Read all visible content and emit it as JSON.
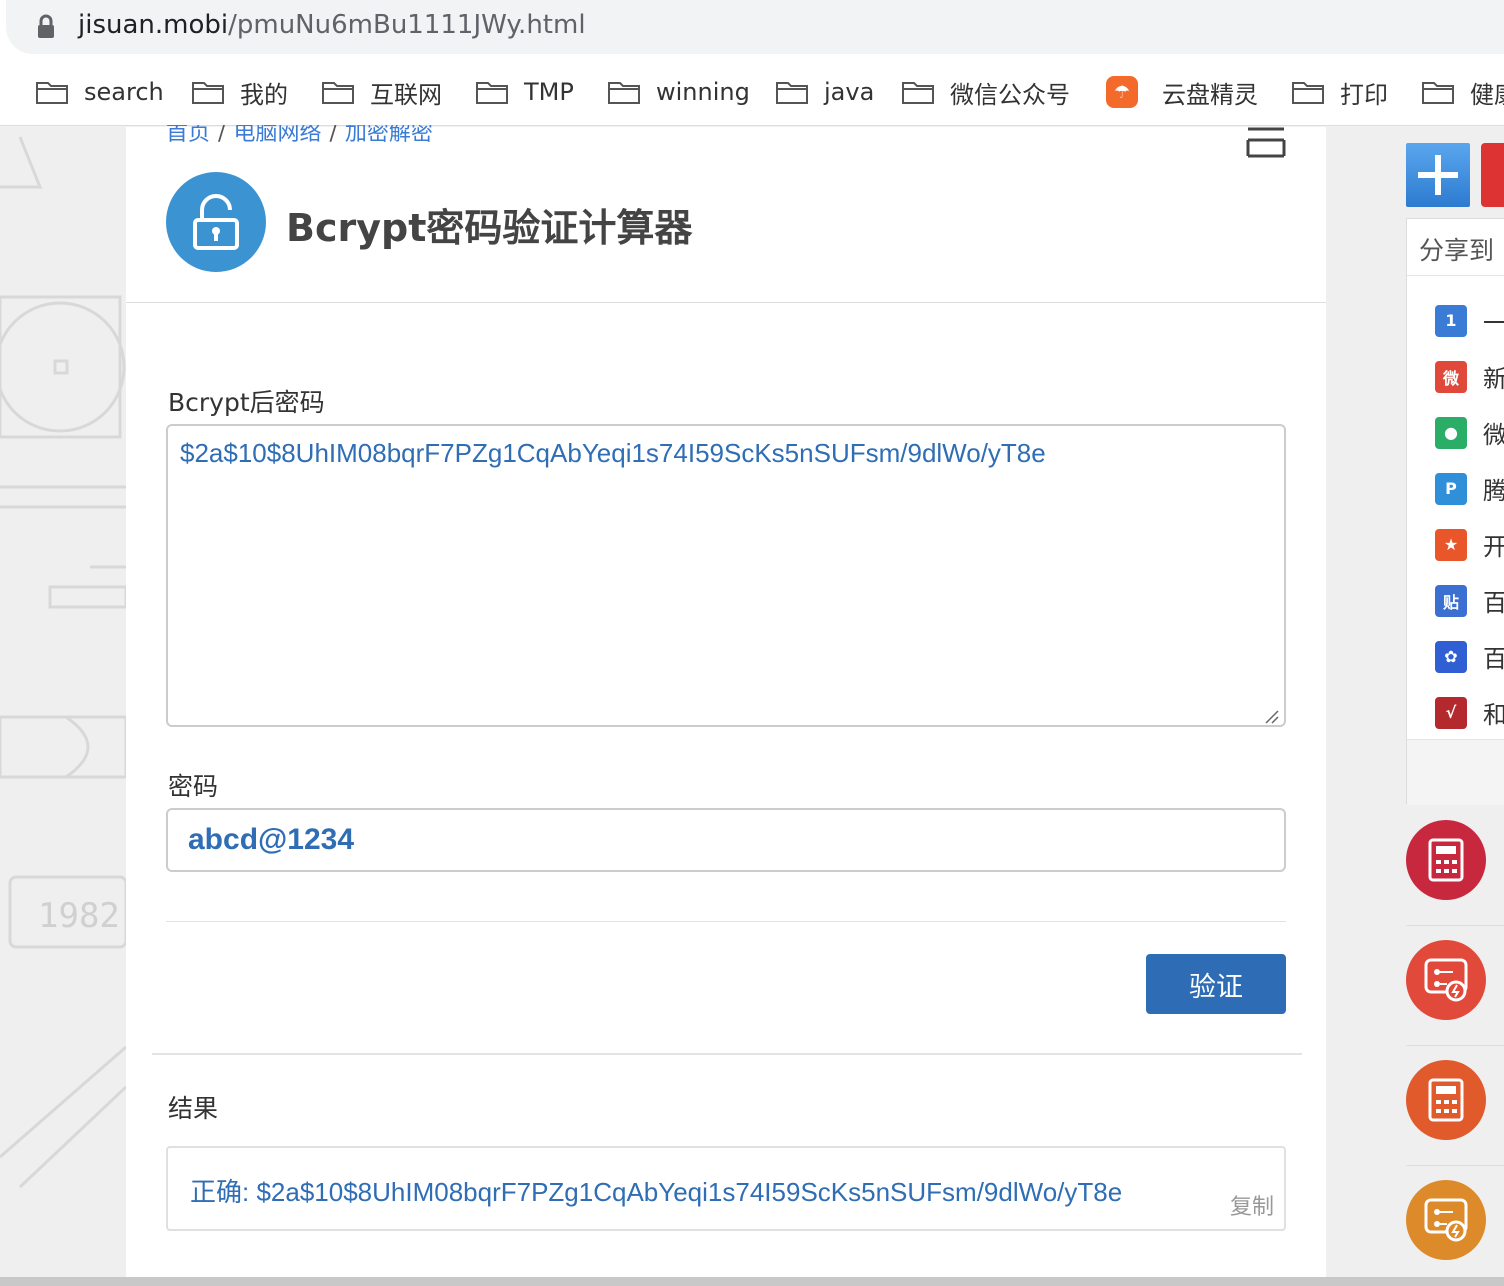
{
  "browser": {
    "url_domain": "jisuan.mobi",
    "url_path": "/pmuNu6mBu1111JWy.html",
    "bookmarks": [
      {
        "label": "search",
        "type": "folder"
      },
      {
        "label": "我的",
        "type": "folder"
      },
      {
        "label": "互联网",
        "type": "folder"
      },
      {
        "label": "TMP",
        "type": "folder"
      },
      {
        "label": "winning",
        "type": "folder"
      },
      {
        "label": "java",
        "type": "folder"
      },
      {
        "label": "微信公众号",
        "type": "folder"
      },
      {
        "label": "云盘精灵",
        "type": "app"
      },
      {
        "label": "打印",
        "type": "folder"
      },
      {
        "label": "健康",
        "type": "folder"
      }
    ]
  },
  "breadcrumb": {
    "home": "首页",
    "category": "电脑网络",
    "subcategory": "加密解密",
    "separator": "/"
  },
  "tool": {
    "title": "Bcrypt密码验证计算器",
    "icon": "lock-icon"
  },
  "form": {
    "hash_label": "Bcrypt后密码",
    "hash_value": "$2a$10$8UhIM08bqrF7PZg1CqAbYeqi1s74I59ScKs5nSUFsm/9dlWo/yT8e",
    "password_label": "密码",
    "password_value": "abcd@1234",
    "verify_button": "验证"
  },
  "result": {
    "label": "结果",
    "text": "正确: $2a$10$8UhIM08bqrF7PZg1CqAbYeqi1s74I59ScKs5nSUFsm/9dlWo/yT8e",
    "copy_label": "复制"
  },
  "share": {
    "title": "分享到",
    "items": [
      {
        "label": "一",
        "icon": "one-icon",
        "color": "#3a7bd5"
      },
      {
        "label": "新",
        "icon": "weibo-icon",
        "color": "#e0493a"
      },
      {
        "label": "微",
        "icon": "wechat-icon",
        "color": "#2aae67"
      },
      {
        "label": "腾",
        "icon": "tencent-icon",
        "color": "#2f8fd8"
      },
      {
        "label": "开",
        "icon": "kaixin-icon",
        "color": "#e8562a"
      },
      {
        "label": "百",
        "icon": "tieba-icon",
        "color": "#3b6fd1"
      },
      {
        "label": "百",
        "icon": "baidu-icon",
        "color": "#2f5fd3"
      },
      {
        "label": "和",
        "icon": "hexun-icon",
        "color": "#b4292e"
      }
    ]
  },
  "side_tools": [
    {
      "icon": "calculator-icon",
      "color": "#c8283e"
    },
    {
      "icon": "circuit-icon",
      "color": "#e14a3a"
    },
    {
      "icon": "calculator-icon",
      "color": "#e05a2c"
    },
    {
      "icon": "circuit-icon",
      "color": "#dd8a2a"
    }
  ]
}
